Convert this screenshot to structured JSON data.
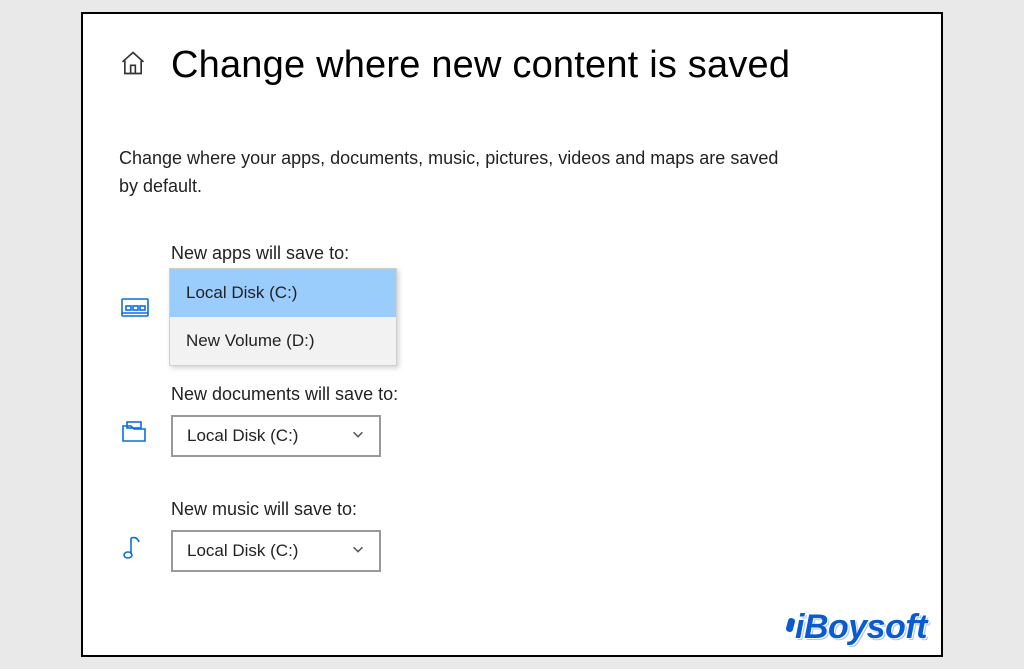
{
  "header": {
    "title": "Change where new content is saved"
  },
  "description": "Change where your apps, documents, music, pictures, videos and maps are saved by default.",
  "sections": {
    "apps": {
      "label": "New apps will save to:",
      "selected": "Local Disk (C:)",
      "options": [
        "Local Disk (C:)",
        "New Volume (D:)"
      ]
    },
    "documents": {
      "label": "New documents will save to:",
      "selected": "Local Disk (C:)"
    },
    "music": {
      "label": "New music will save to:",
      "selected": "Local Disk (C:)"
    }
  },
  "watermark": "iBoysoft"
}
